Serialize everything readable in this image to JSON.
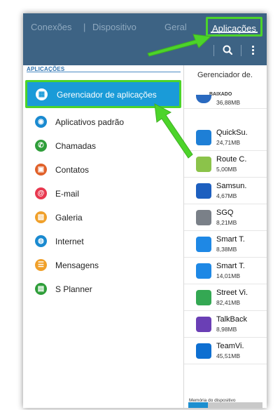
{
  "topbar": {
    "tabs": [
      {
        "label": "Conexões"
      },
      {
        "label": "Dispositivo"
      },
      {
        "label": "Geral"
      },
      {
        "label": "Aplicações",
        "active": true
      }
    ],
    "separator": "|",
    "accent_color": "#3d6384",
    "highlight_color": "#4cd42a"
  },
  "left": {
    "section_title": "APLICAÇÕES",
    "items": [
      {
        "label": "Gerenciador de aplicações",
        "icon": "grid-icon",
        "icon_color": "#1a9bd8",
        "selected": true
      },
      {
        "label": "Aplicativos padrão",
        "icon": "apps-default-icon",
        "icon_color": "#1a8ad0"
      },
      {
        "label": "Chamadas",
        "icon": "phone-icon",
        "icon_color": "#2f9e3a"
      },
      {
        "label": "Contatos",
        "icon": "contacts-icon",
        "icon_color": "#e0612a"
      },
      {
        "label": "E-mail",
        "icon": "email-icon",
        "icon_color": "#e8384f"
      },
      {
        "label": "Galeria",
        "icon": "gallery-icon",
        "icon_color": "#f0a02a"
      },
      {
        "label": "Internet",
        "icon": "globe-icon",
        "icon_color": "#1a8ad0"
      },
      {
        "label": "Mensagens",
        "icon": "messages-icon",
        "icon_color": "#f0a02a"
      },
      {
        "label": "S Planner",
        "icon": "calendar-icon",
        "icon_color": "#2f9e3a"
      }
    ]
  },
  "right": {
    "header": "Gerenciador de.",
    "section": "BAIXADO",
    "apps": [
      {
        "name": "",
        "size": "36,88MB",
        "icon_color": "#2a6ac0"
      },
      {
        "name": "QuickSu.",
        "size": "24,71MB",
        "icon_color": "#1e7fd6"
      },
      {
        "name": "Route C.",
        "size": "5,00MB",
        "icon_color": "#8bc34a"
      },
      {
        "name": "Samsun.",
        "size": "4,67MB",
        "icon_color": "#1d5fbf"
      },
      {
        "name": "SGQ",
        "size": "8,21MB",
        "icon_color": "#7a8088"
      },
      {
        "name": "Smart T.",
        "size": "8,38MB",
        "icon_color": "#1e88e5"
      },
      {
        "name": "Smart T.",
        "size": "14,01MB",
        "icon_color": "#1e88e5"
      },
      {
        "name": "Street Vi.",
        "size": "82,41MB",
        "icon_color": "#34a853"
      },
      {
        "name": "TalkBack",
        "size": "8,98MB",
        "icon_color": "#6a3fb5"
      },
      {
        "name": "TeamVi.",
        "size": "45,51MB",
        "icon_color": "#0e6fd1"
      }
    ],
    "memory_label": "Memória do dispositivo",
    "memory_used_fraction": 0.26
  }
}
